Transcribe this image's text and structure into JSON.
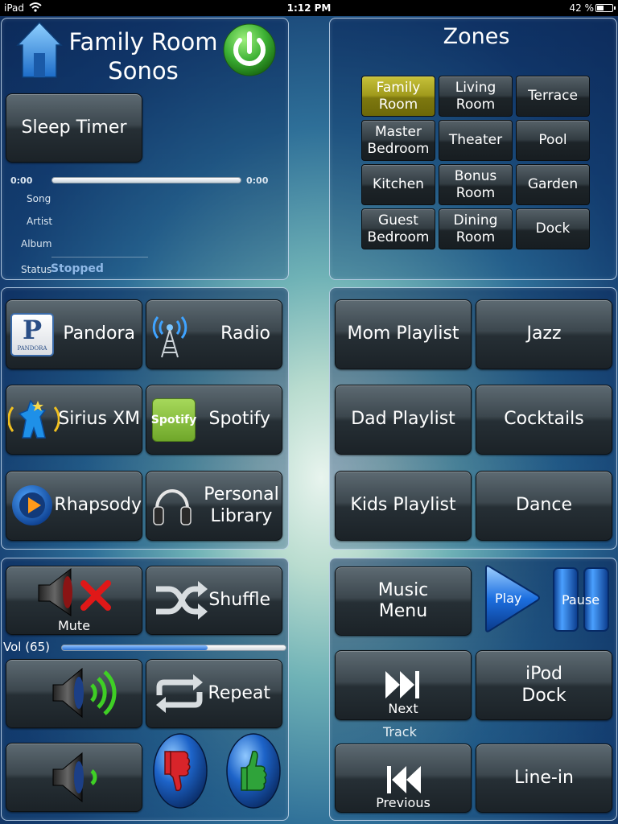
{
  "status_bar": {
    "device": "iPad",
    "time": "1:12 PM",
    "battery": "42 %"
  },
  "now_playing": {
    "title_line1": "Family Room",
    "title_line2": "Sonos",
    "sleep_timer_label": "Sleep Timer",
    "time_elapsed": "0:00",
    "time_total": "0:00",
    "progress": 0,
    "song_label": "Song",
    "artist_label": "Artist",
    "album_label": "Album",
    "status_label": "Status",
    "status_value": "Stopped"
  },
  "zones": {
    "title": "Zones",
    "items": [
      {
        "label": "Family\nRoom",
        "active": true
      },
      {
        "label": "Living\nRoom",
        "active": false
      },
      {
        "label": "Terrace",
        "active": false
      },
      {
        "label": "Master\nBedroom",
        "active": false
      },
      {
        "label": "Theater",
        "active": false
      },
      {
        "label": "Pool",
        "active": false
      },
      {
        "label": "Kitchen",
        "active": false
      },
      {
        "label": "Bonus\nRoom",
        "active": false
      },
      {
        "label": "Garden",
        "active": false
      },
      {
        "label": "Guest\nBedroom",
        "active": false
      },
      {
        "label": "Dining\nRoom",
        "active": false
      },
      {
        "label": "Dock",
        "active": false
      }
    ]
  },
  "sources": {
    "pandora": "Pandora",
    "pandora_logo_letter": "P",
    "pandora_logo_text": "PANDORA",
    "radio": "Radio",
    "sirius": "Sirius XM",
    "spotify": "Spotify",
    "spotify_logo_text": "Spotify",
    "rhapsody": "Rhapsody",
    "library_line1": "Personal",
    "library_line2": "Library"
  },
  "playlists": {
    "mom": "Mom Playlist",
    "jazz": "Jazz",
    "dad": "Dad Playlist",
    "cocktails": "Cocktails",
    "kids": "Kids Playlist",
    "dance": "Dance"
  },
  "controls": {
    "mute": "Mute",
    "shuffle": "Shuffle",
    "volume_label": "Vol (65)",
    "volume_value": 65,
    "repeat": "Repeat"
  },
  "transport": {
    "music_menu_line1": "Music",
    "music_menu_line2": "Menu",
    "play": "Play",
    "pause": "Pause",
    "next": "Next",
    "track": "Track",
    "ipod_line1": "iPod",
    "ipod_line2": "Dock",
    "previous": "Previous",
    "line_in": "Line-in"
  },
  "colors": {
    "zone_active": "#a09a1c",
    "power_green": "#3cb034",
    "play_blue": "#1c6fe0",
    "thumbs_down": "#d8242a",
    "thumbs_up": "#2fa33a"
  }
}
